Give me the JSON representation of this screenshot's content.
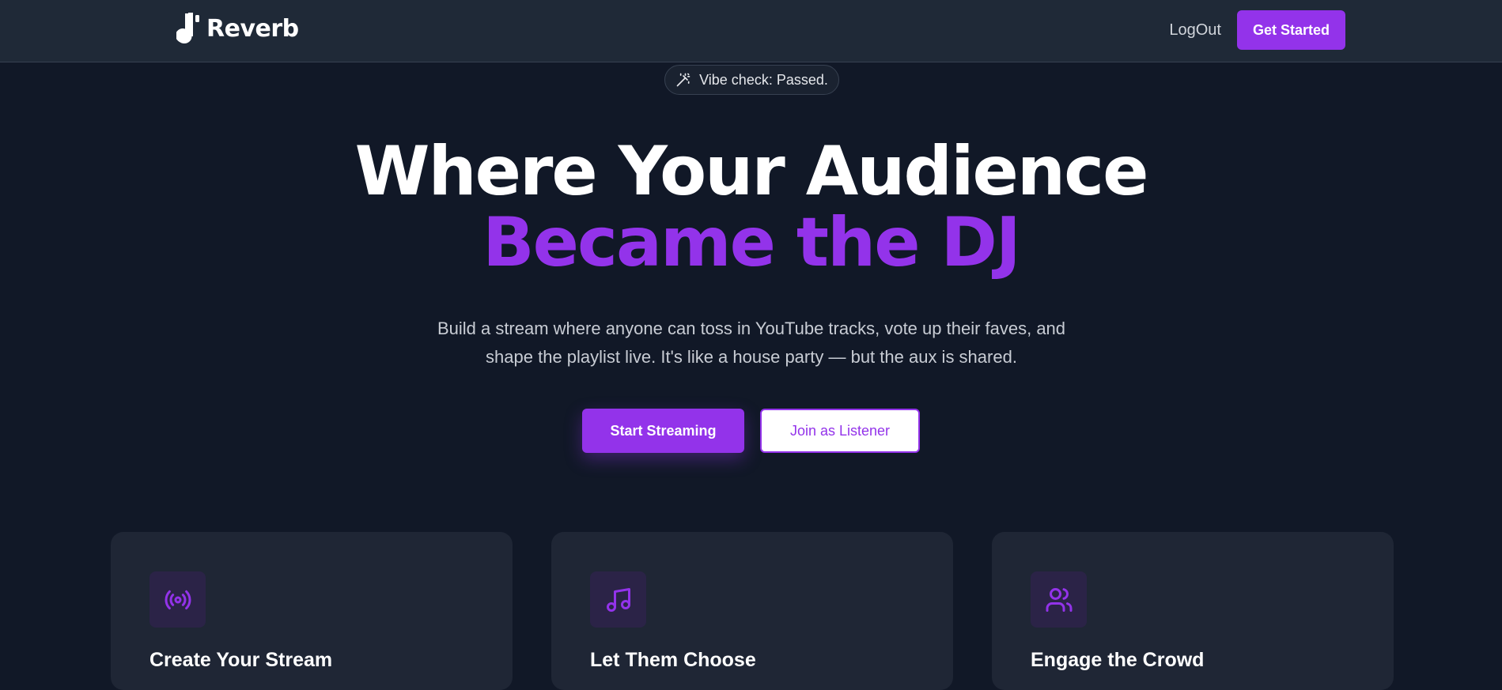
{
  "brand": {
    "name": "Reverb"
  },
  "nav": {
    "logout": "LogOut",
    "get_started": "Get Started"
  },
  "badge": {
    "icon": "magic-wand-icon",
    "text": "Vibe check: Passed."
  },
  "hero": {
    "line1": "Where Your Audience",
    "line2": "Became the DJ",
    "description": "Build a stream where anyone can toss in YouTube tracks, vote up their faves, and shape the playlist live. It's like a house party — but the aux is shared."
  },
  "cta": {
    "primary": "Start Streaming",
    "secondary": "Join as Listener"
  },
  "features": [
    {
      "icon": "radio-broadcast-icon",
      "title": "Create Your Stream"
    },
    {
      "icon": "music-note-icon",
      "title": "Let Them Choose"
    },
    {
      "icon": "users-icon",
      "title": "Engage the Crowd"
    }
  ],
  "colors": {
    "accent": "#9333ea",
    "background": "#111827",
    "navbar": "#1f2937",
    "card": "#1f2635"
  }
}
